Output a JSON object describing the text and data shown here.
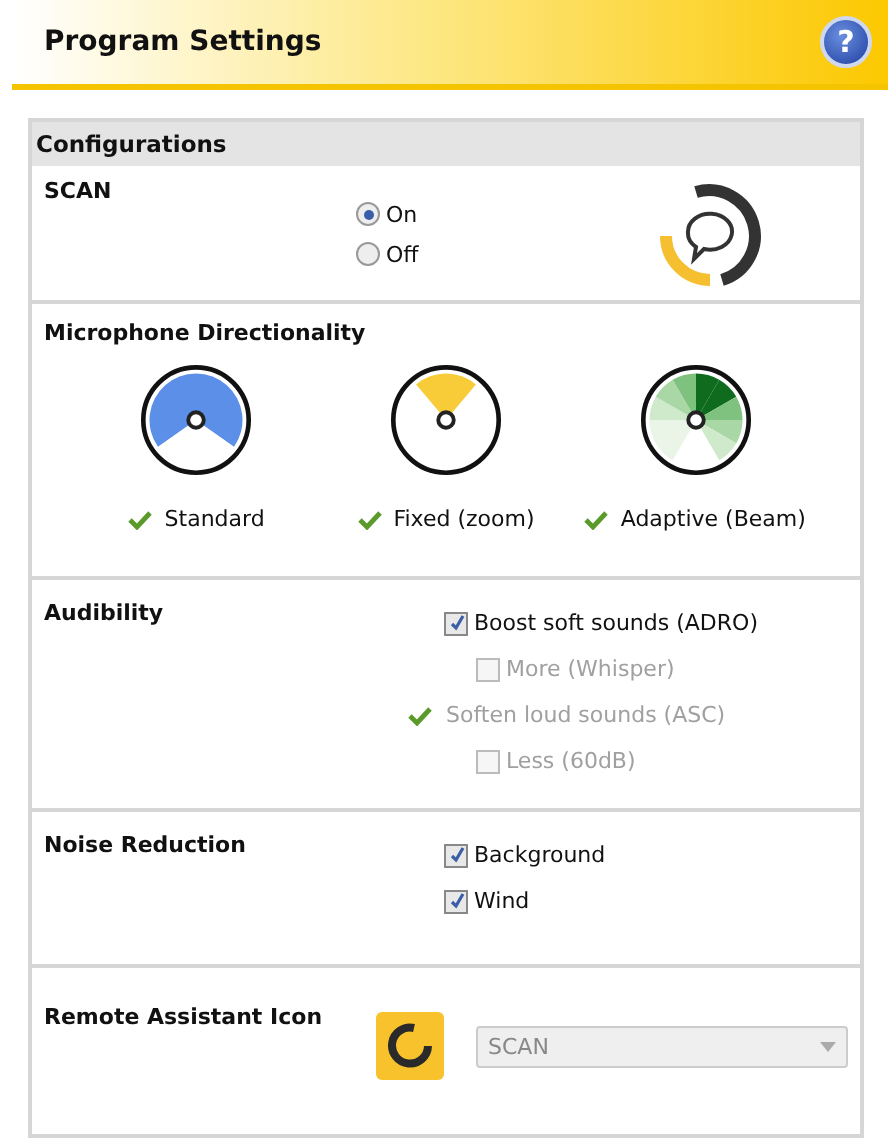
{
  "header": {
    "title": "Program Settings",
    "help": "?"
  },
  "panel": {
    "title": "Configurations"
  },
  "scan": {
    "label": "SCAN",
    "options": [
      {
        "label": "On",
        "selected": true
      },
      {
        "label": "Off",
        "selected": false
      }
    ]
  },
  "directionality": {
    "label": "Microphone Directionality",
    "modes": [
      {
        "kind": "standard",
        "label": "Standard"
      },
      {
        "kind": "fixed",
        "label": "Fixed (zoom)"
      },
      {
        "kind": "adaptive",
        "label": "Adaptive (Beam)"
      }
    ]
  },
  "audibility": {
    "label": "Audibility",
    "options": [
      {
        "kind": "checkbox",
        "label": "Boost soft sounds (ADRO)",
        "checked": true,
        "disabled": false,
        "children": [
          {
            "kind": "checkbox",
            "label": "More (Whisper)",
            "checked": false,
            "disabled": true
          }
        ]
      },
      {
        "kind": "tick",
        "label": "Soften loud sounds (ASC)",
        "disabled": true,
        "children": [
          {
            "kind": "checkbox",
            "label": "Less (60dB)",
            "checked": false,
            "disabled": true
          }
        ]
      }
    ]
  },
  "noise_reduction": {
    "label": "Noise Reduction",
    "options": [
      {
        "label": "Background",
        "checked": true
      },
      {
        "label": "Wind",
        "checked": true
      }
    ]
  },
  "remote_assistant_icon": {
    "label": "Remote Assistant Icon",
    "dropdown": {
      "value": "SCAN",
      "disabled": true
    }
  }
}
